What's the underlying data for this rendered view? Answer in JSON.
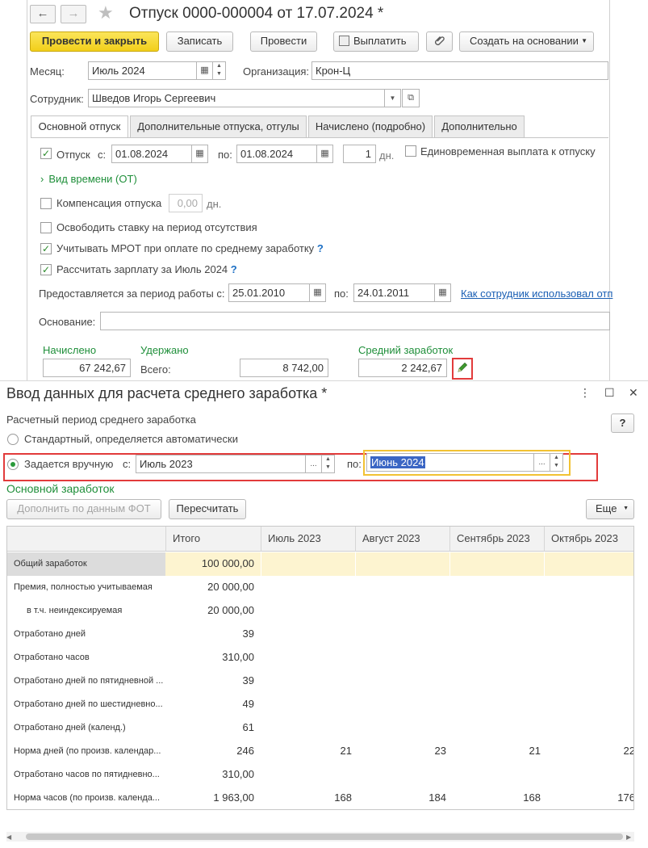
{
  "doc": {
    "title": "Отпуск 0000-000004 от 17.07.2024 *",
    "nav_back": "←",
    "nav_forward": "→",
    "toolbar": {
      "post_close": "Провести и закрыть",
      "save": "Записать",
      "post": "Провести",
      "pay": "Выплатить",
      "attach_icon": "paperclip-icon",
      "create_based": "Создать на основании"
    },
    "month_label": "Месяц:",
    "month_value": "Июль 2024",
    "org_label": "Организация:",
    "org_value": "Крон-Ц",
    "employee_label": "Сотрудник:",
    "employee_value": "Шведов Игорь Сергеевич",
    "tabs": [
      "Основной отпуск",
      "Дополнительные отпуска, отгулы",
      "Начислено (подробно)",
      "Дополнительно"
    ],
    "vacation": {
      "label": "Отпуск",
      "from_label": "с:",
      "from": "01.08.2024",
      "to_label": "по:",
      "to": "01.08.2024",
      "days": "1",
      "days_unit": "дн.",
      "one_time_label": "Единовременная выплата к отпуску"
    },
    "time_type": "Вид времени (ОТ)",
    "compensation_label": "Компенсация отпуска",
    "compensation_value": "0,00",
    "compensation_unit": "дн.",
    "release_rate": "Освободить ставку на период отсутствия",
    "mrot": "Учитывать МРОТ при оплате по среднему заработку",
    "calc_salary": "Рассчитать зарплату за Июль 2024",
    "help": "?",
    "period_label": "Предоставляется за период работы с:",
    "period_from": "25.01.2010",
    "period_to_label": "по:",
    "period_to": "24.01.2011",
    "employee_link": "Как сотрудник использовал отп",
    "reason_label": "Основание:",
    "accrued_label": "Начислено",
    "accrued_value": "67 242,67",
    "withheld_label": "Удержано",
    "total_label": "Всего:",
    "withheld_value": "8 742,00",
    "avg_label": "Средний заработок",
    "avg_value": "2 242,67"
  },
  "dialog": {
    "title": "Ввод данных для расчета среднего заработка *",
    "help": "?",
    "period_heading": "Расчетный период среднего заработка",
    "opt_standard": "Стандартный, определяется автоматически",
    "opt_manual": "Задается вручную",
    "from_label": "с:",
    "from_value": "Июль 2023",
    "to_label": "по:",
    "to_value": "Июнь 2024",
    "section": "Основной заработок",
    "fill_btn": "Дополнить по данным ФОТ",
    "recalc_btn": "Пересчитать",
    "more_btn": "Еще",
    "table": {
      "columns": [
        "Итого",
        "Июль 2023",
        "Август 2023",
        "Сентябрь 2023",
        "Октябрь 2023"
      ],
      "rows": [
        {
          "name": "Общий заработок",
          "total": "100 000,00",
          "m": [
            "",
            "",
            "",
            ""
          ]
        },
        {
          "name": "Премия, полностью учитываемая",
          "total": "20 000,00",
          "m": [
            "",
            "",
            "",
            ""
          ]
        },
        {
          "name": "в т.ч. неиндексируемая",
          "total": "20 000,00",
          "m": [
            "",
            "",
            "",
            ""
          ]
        },
        {
          "name": "Отработано дней",
          "total": "39",
          "m": [
            "",
            "",
            "",
            ""
          ]
        },
        {
          "name": "Отработано часов",
          "total": "310,00",
          "m": [
            "",
            "",
            "",
            ""
          ]
        },
        {
          "name": "Отработано дней по пятидневной ...",
          "total": "39",
          "m": [
            "",
            "",
            "",
            ""
          ]
        },
        {
          "name": "Отработано дней по шестидневно...",
          "total": "49",
          "m": [
            "",
            "",
            "",
            ""
          ]
        },
        {
          "name": "Отработано дней (календ.)",
          "total": "61",
          "m": [
            "",
            "",
            "",
            ""
          ]
        },
        {
          "name": "Норма дней (по произв. календар...",
          "total": "246",
          "m": [
            "21",
            "23",
            "21",
            "22"
          ]
        },
        {
          "name": "Отработано часов по пятидневно...",
          "total": "310,00",
          "m": [
            "",
            "",
            "",
            ""
          ]
        },
        {
          "name": "Норма часов (по произв. календа...",
          "total": "1 963,00",
          "m": [
            "168",
            "184",
            "168",
            "176"
          ]
        }
      ]
    }
  },
  "colors": {
    "primary_button": "#f2cf1a",
    "green_text": "#1f8f3a",
    "highlight_red": "#e23b3b",
    "highlight_yellow": "#f2c233",
    "selected_row": "#fdf4d0",
    "selection": "#3b66c4"
  }
}
